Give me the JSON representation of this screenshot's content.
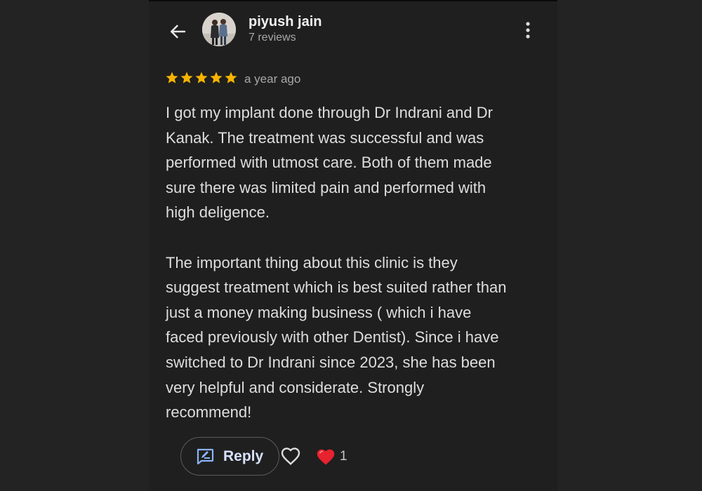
{
  "header": {
    "back_icon": "arrow-left-icon",
    "reviewer_name": "piyush jain",
    "review_count": "7 reviews",
    "menu_icon": "more-vert-icon"
  },
  "review": {
    "rating": 5,
    "max_rating": 5,
    "star_color": "#f6b400",
    "time": "a year ago",
    "text": "I got my implant done through Dr Indrani and Dr\nKanak. The treatment was successful and was\nperformed with utmost care. Both of them made\nsure there was limited pain and performed with\nhigh deligence.\n\nThe important thing about this clinic is they\nsuggest treatment which is best suited rather than\njust a money making business ( which i have\nfaced previously with other Dentist). Since i have\nswitched to Dr Indrani since 2023, she has been\nvery helpful and considerate. Strongly\nrecommend!"
  },
  "actions": {
    "reply_label": "Reply",
    "reply_icon": "reply-edit-icon",
    "like_icon": "heart-outline-icon",
    "reaction_icon": "red-heart-icon",
    "reaction_count": "1",
    "accent_color": "#8ab4f8"
  }
}
